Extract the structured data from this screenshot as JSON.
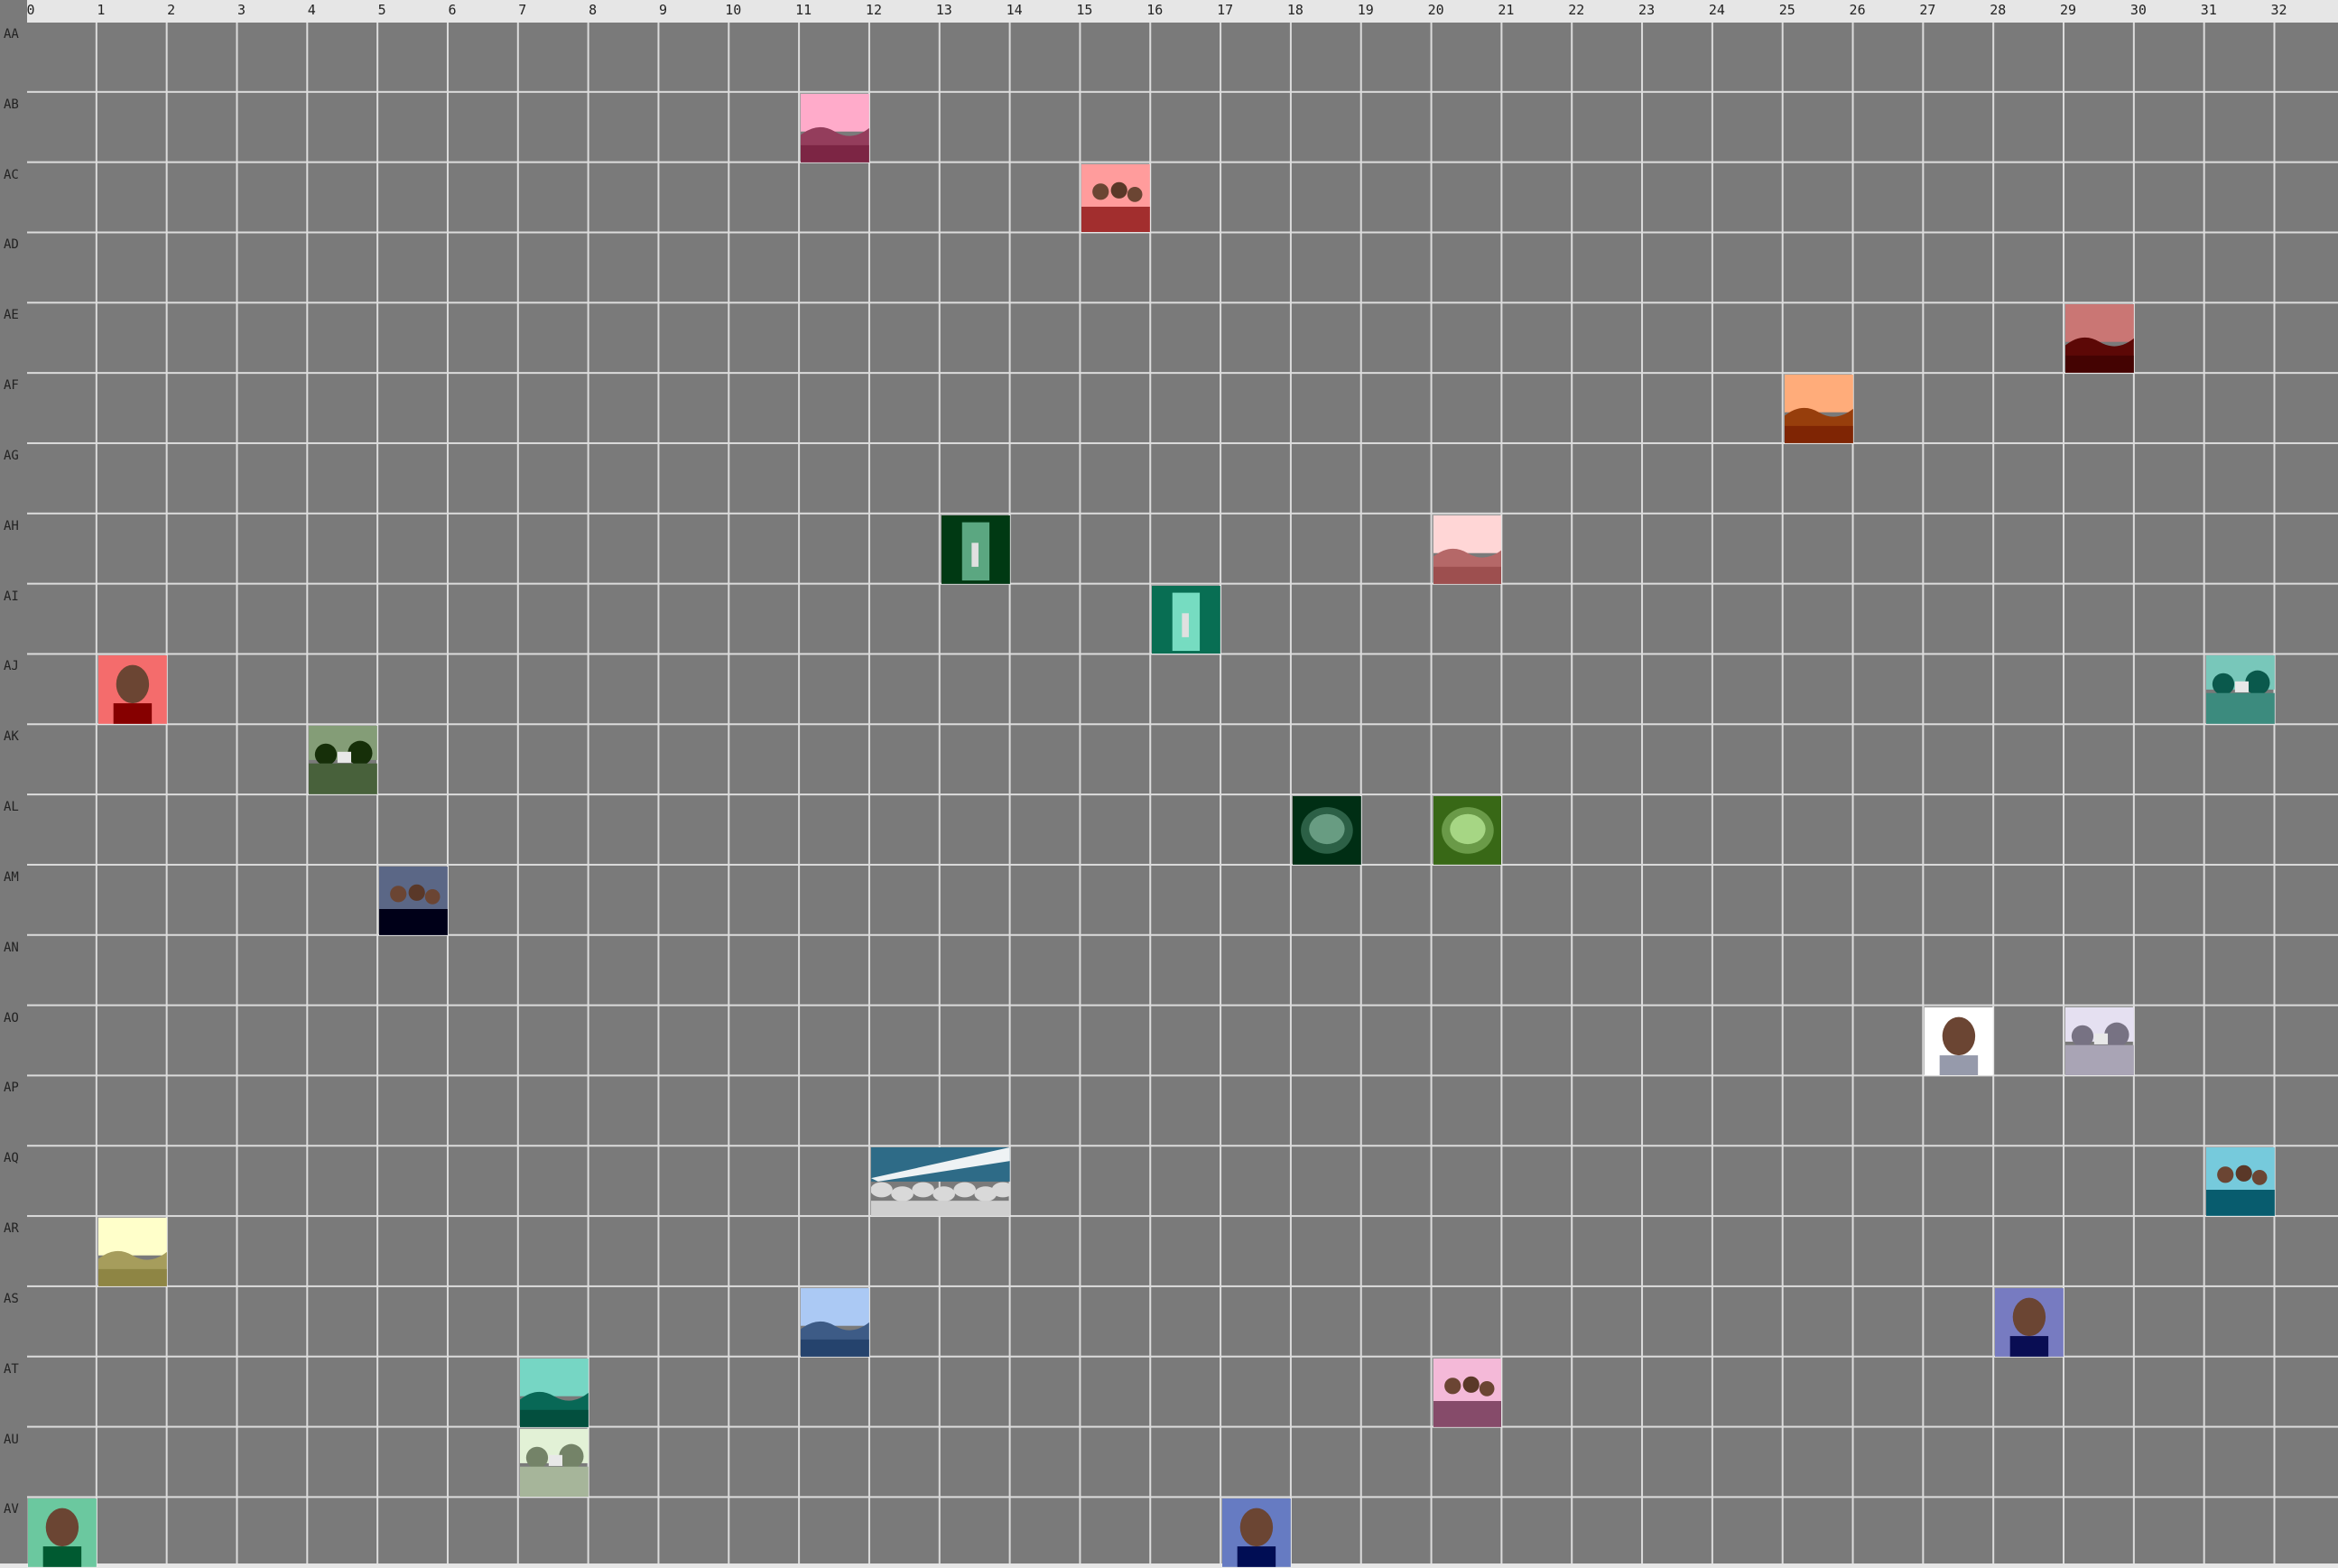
{
  "grid": {
    "columns": [
      "0",
      "1",
      "2",
      "3",
      "4",
      "5",
      "6",
      "7",
      "8",
      "9",
      "10",
      "11",
      "12",
      "13",
      "14",
      "15",
      "16",
      "17",
      "18",
      "19",
      "20",
      "21",
      "22",
      "23",
      "24",
      "25",
      "26",
      "27",
      "28",
      "29",
      "30",
      "31",
      "32"
    ],
    "rows": [
      "AA",
      "AB",
      "AC",
      "AD",
      "AE",
      "AF",
      "AG",
      "AH",
      "AI",
      "AJ",
      "AK",
      "AL",
      "AM",
      "AN",
      "AO",
      "AP",
      "AQ",
      "AR",
      "AS",
      "AT",
      "AU",
      "AV"
    ],
    "colors": {
      "background": "#7a7a7a",
      "lines": "#dcdcdc",
      "header": "#e6e6e6"
    }
  },
  "tiles": [
    {
      "id": "AB-11",
      "row": 1,
      "col": 11,
      "span": 1,
      "scene": "pink-sky-landscape",
      "tint": "#c66f8e"
    },
    {
      "id": "AC-15",
      "row": 2,
      "col": 15,
      "span": 1,
      "scene": "people-indoors",
      "tint": "#d46060"
    },
    {
      "id": "AE-29",
      "row": 4,
      "col": 29,
      "span": 1,
      "scene": "red-mountain",
      "tint": "#8e3a38"
    },
    {
      "id": "AF-25",
      "row": 5,
      "col": 25,
      "span": 1,
      "scene": "desert-field",
      "tint": "#c9703e"
    },
    {
      "id": "AH-13",
      "row": 7,
      "col": 13,
      "span": 1,
      "scene": "green-doorway",
      "tint": "#1f6b45"
    },
    {
      "id": "AH-20",
      "row": 7,
      "col": 20,
      "span": 1,
      "scene": "mountain-horizon",
      "tint": "#e79a9a"
    },
    {
      "id": "AI-16",
      "row": 8,
      "col": 16,
      "span": 1,
      "scene": "room-interior",
      "tint": "#3aa085"
    },
    {
      "id": "AJ-1",
      "row": 9,
      "col": 1,
      "span": 1,
      "scene": "child-portrait",
      "tint": "#b83030"
    },
    {
      "id": "AJ-31",
      "row": 9,
      "col": 31,
      "span": 1,
      "scene": "teal-village",
      "tint": "#3c8b7e"
    },
    {
      "id": "AK-4",
      "row": 10,
      "col": 4,
      "span": 1,
      "scene": "church-field",
      "tint": "#48613b"
    },
    {
      "id": "AL-18",
      "row": 11,
      "col": 18,
      "span": 1,
      "scene": "green-foliage",
      "tint": "#2c6046"
    },
    {
      "id": "AL-20",
      "row": 11,
      "col": 20,
      "span": 1,
      "scene": "green-bowl",
      "tint": "#6a9a48"
    },
    {
      "id": "AM-5",
      "row": 12,
      "col": 5,
      "span": 1,
      "scene": "people-water",
      "tint": "#1f2b4a"
    },
    {
      "id": "AO-27",
      "row": 14,
      "col": 27,
      "span": 1,
      "scene": "person-standing",
      "tint": "#c8ccdd"
    },
    {
      "id": "AO-29",
      "row": 14,
      "col": 29,
      "span": 1,
      "scene": "house-road",
      "tint": "#a9a4b5"
    },
    {
      "id": "AQ-12",
      "row": 16,
      "col": 12,
      "span": 2,
      "scene": "rocks-sky",
      "tint": "#8fb3c8"
    },
    {
      "id": "AQ-31",
      "row": 16,
      "col": 31,
      "span": 1,
      "scene": "people-sitting",
      "tint": "#3a8ea0"
    },
    {
      "id": "AR-1",
      "row": 17,
      "col": 1,
      "span": 1,
      "scene": "sunset-coast",
      "tint": "#d8cf8e"
    },
    {
      "id": "AS-11",
      "row": 18,
      "col": 11,
      "span": 1,
      "scene": "blue-hillside",
      "tint": "#6f8db8"
    },
    {
      "id": "AS-28",
      "row": 18,
      "col": 28,
      "span": 1,
      "scene": "person-beach",
      "tint": "#3b3f85"
    },
    {
      "id": "AT-7",
      "row": 19,
      "col": 7,
      "span": 1,
      "scene": "teal-hill",
      "tint": "#3a9a88"
    },
    {
      "id": "AT-20",
      "row": 19,
      "col": 20,
      "span": 1,
      "scene": "group-photo",
      "tint": "#b87d9c"
    },
    {
      "id": "AU-7",
      "row": 20,
      "col": 7,
      "span": 1,
      "scene": "park-trees",
      "tint": "#a6b59a"
    },
    {
      "id": "AV-0",
      "row": 21,
      "col": 0,
      "span": 1,
      "scene": "smiling-woman",
      "tint": "#2f8c63"
    },
    {
      "id": "AV-17",
      "row": 21,
      "col": 17,
      "span": 1,
      "scene": "boy-portrait",
      "tint": "#2a3f86"
    }
  ]
}
